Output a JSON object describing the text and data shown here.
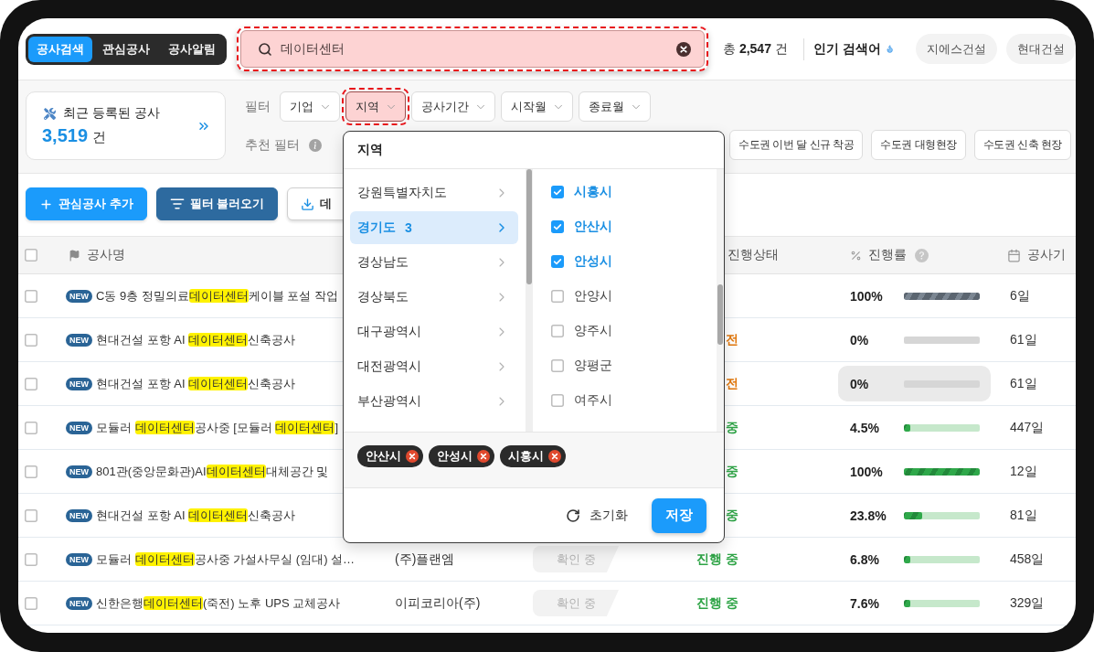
{
  "nav_tabs": [
    {
      "label": "공사검색",
      "selected": true
    },
    {
      "label": "관심공사",
      "selected": false
    },
    {
      "label": "공사알림",
      "selected": false
    }
  ],
  "search": {
    "value": "데이터센터",
    "highlighted": true
  },
  "result_count": "총 **2,547** 건",
  "popular_searches": {
    "label": "인기 검색어",
    "keywords": [
      "지에스건설",
      "현대건설"
    ]
  },
  "recent_card": {
    "title": "최근 등록된 공사",
    "count": "3,519",
    "unit": "건"
  },
  "filters": {
    "label": "필터",
    "chips": [
      {
        "label": "기업",
        "highlighted": false
      },
      {
        "label": "지역",
        "highlighted": true
      },
      {
        "label": "공사기간",
        "highlighted": false
      },
      {
        "label": "시작월",
        "highlighted": false
      },
      {
        "label": "종료월",
        "highlighted": false
      }
    ]
  },
  "recommended_filters": {
    "label": "추천 필터",
    "chips": [
      "수도권 이번 달 신규 착공",
      "수도권 대형현장",
      "수도권 신축 현장"
    ]
  },
  "actions": [
    {
      "kind": "add",
      "label": "관심공사 추가"
    },
    {
      "kind": "load",
      "label": "필터 불러오기"
    },
    {
      "kind": "download",
      "label": "데"
    }
  ],
  "table": {
    "all_checked": false,
    "columns": [
      {
        "kind": "name",
        "label": "공사명"
      },
      {
        "kind": "status",
        "label": "진행상태"
      },
      {
        "kind": "progress",
        "label": "진행률"
      },
      {
        "kind": "duration",
        "label": "공사기"
      }
    ],
    "rows": [
      {
        "checked": false,
        "badge": "NEW",
        "name": [
          {
            "text": "C동 9층 정밀의료",
            "highlighted": false
          },
          {
            "text": "데이터센터",
            "highlighted": true
          },
          {
            "text": "케이블 포설 작업",
            "highlighted": false
          }
        ],
        "kind": "completed",
        "progress": "100%",
        "level": 1,
        "hovered": false,
        "duration": "6일"
      },
      {
        "checked": false,
        "badge": "NEW",
        "name": [
          {
            "text": "현대건설 포항 AI ",
            "highlighted": false
          },
          {
            "text": "데이터센터",
            "highlighted": true
          },
          {
            "text": "신축공사",
            "highlighted": false
          }
        ],
        "status": "전",
        "kind": "pending",
        "progress": "0%",
        "level": 0,
        "hovered": false,
        "duration": "61일"
      },
      {
        "checked": false,
        "badge": "NEW",
        "name": [
          {
            "text": "현대건설 포항 AI ",
            "highlighted": false
          },
          {
            "text": "데이터센터",
            "highlighted": true
          },
          {
            "text": "신축공사",
            "highlighted": false
          }
        ],
        "status": "전",
        "kind": "pending",
        "progress": "0%",
        "level": 0,
        "hovered": true,
        "duration": "61일"
      },
      {
        "checked": false,
        "badge": "NEW",
        "name": [
          {
            "text": "모듈러 ",
            "highlighted": false
          },
          {
            "text": "데이터센터",
            "highlighted": true
          },
          {
            "text": "공사중 [모듈러 ",
            "highlighted": false
          },
          {
            "text": "데이터센터",
            "highlighted": true
          },
          {
            "text": "]",
            "highlighted": false
          }
        ],
        "status": "중",
        "kind": "ongoing",
        "progress": "4.5%",
        "level": 0.045,
        "hovered": false,
        "duration": "447일"
      },
      {
        "checked": false,
        "badge": "NEW",
        "name": [
          {
            "text": "801관(중앙문화관)AI",
            "highlighted": false
          },
          {
            "text": "데이터센터",
            "highlighted": true
          },
          {
            "text": "대체공간 및",
            "highlighted": false
          }
        ],
        "status": "중",
        "kind": "ongoing",
        "progress": "100%",
        "level": 1,
        "hovered": false,
        "duration": "12일"
      },
      {
        "checked": false,
        "badge": "NEW",
        "name": [
          {
            "text": "현대건설 포항 AI ",
            "highlighted": false
          },
          {
            "text": "데이터센터",
            "highlighted": true
          },
          {
            "text": "신축공사",
            "highlighted": false
          }
        ],
        "status": "중",
        "kind": "ongoing",
        "progress": "23.8%",
        "level": 0.238,
        "hovered": false,
        "duration": "81일"
      },
      {
        "checked": false,
        "badge": "NEW",
        "name": [
          {
            "text": "모듈러 ",
            "highlighted": false
          },
          {
            "text": "데이터센터",
            "highlighted": true
          },
          {
            "text": "공사중 가설사무실 (임대) 설…",
            "highlighted": false
          }
        ],
        "company": "(주)플랜엠",
        "tag": "확인 중",
        "status": "진행 중",
        "kind": "ongoing",
        "progress": "6.8%",
        "level": 0.068,
        "hovered": false,
        "duration": "458일"
      },
      {
        "checked": false,
        "badge": "NEW",
        "name": [
          {
            "text": "신한은행",
            "highlighted": false
          },
          {
            "text": "데이터센터",
            "highlighted": true
          },
          {
            "text": "(죽전) 노후 UPS 교체공사",
            "highlighted": false
          }
        ],
        "company": "이피코리아(주)",
        "tag": "확인 중",
        "status": "진행 중",
        "kind": "ongoing",
        "progress": "7.6%",
        "level": 0.076,
        "hovered": false,
        "duration": "329일"
      }
    ]
  },
  "region_dropdown": {
    "title": "지역",
    "provinces": [
      {
        "label": "강원특별자치도",
        "selected": false
      },
      {
        "label": "경기도",
        "count": "3",
        "selected": true
      },
      {
        "label": "경상남도",
        "selected": false
      },
      {
        "label": "경상북도",
        "selected": false
      },
      {
        "label": "대구광역시",
        "selected": false
      },
      {
        "label": "대전광역시",
        "selected": false
      },
      {
        "label": "부산광역시",
        "selected": false
      }
    ],
    "cities": [
      {
        "label": "시흥시",
        "checked": true
      },
      {
        "label": "안산시",
        "checked": true
      },
      {
        "label": "안성시",
        "checked": true
      },
      {
        "label": "안양시",
        "checked": false
      },
      {
        "label": "양주시",
        "checked": false
      },
      {
        "label": "양평군",
        "checked": false
      },
      {
        "label": "여주시",
        "checked": false
      }
    ],
    "selected_tags": [
      "안산시",
      "안성시",
      "시흥시"
    ],
    "reset_label": "초기화",
    "save_label": "저장"
  }
}
